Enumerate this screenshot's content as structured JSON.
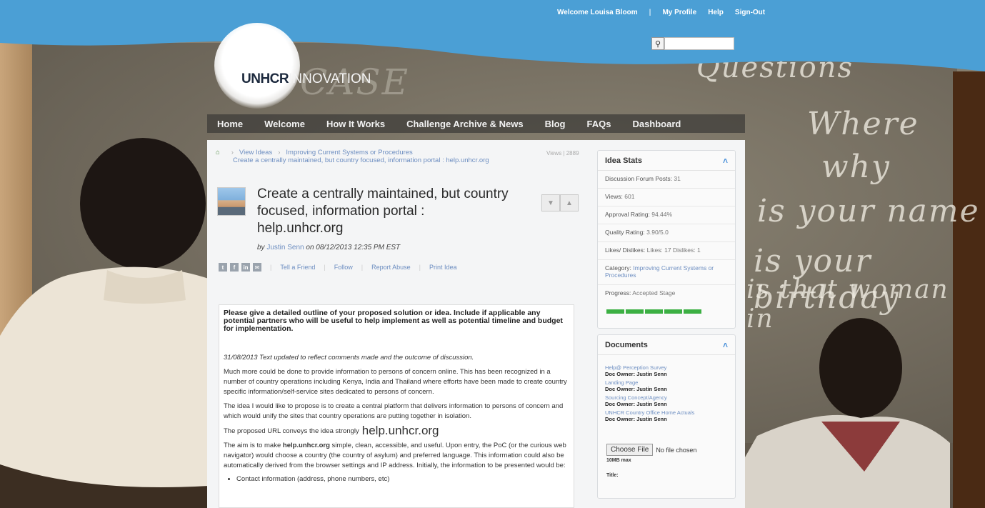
{
  "header": {
    "welcome": "Welcome Louisa Bloom",
    "links": [
      "My Profile",
      "Help",
      "Sign-Out"
    ],
    "logo_main": "UNHCR",
    "logo_sub": "INNOVATION",
    "search_icon": "search-icon"
  },
  "nav": [
    "Home",
    "Welcome",
    "How It Works",
    "Challenge Archive & News",
    "Blog",
    "FAQs",
    "Dashboard"
  ],
  "breadcrumb": {
    "home_icon": "home-icon",
    "items": [
      "View Ideas",
      "Improving Current Systems or Procedures",
      "Create a centrally maintained, but country focused, information portal : help.unhcr.org"
    ],
    "views_label": "Views | 2889"
  },
  "idea": {
    "title": "Create a centrally maintained, but country focused, information portal : help.unhcr.org",
    "by_prefix": "by",
    "author": "Justin Senn",
    "date": "on 08/12/2013 12:35 PM EST",
    "share_icons": [
      "twitter-icon",
      "facebook-icon",
      "linkedin-icon",
      "email-icon"
    ],
    "actions": [
      "Tell a Friend",
      "Follow",
      "Report Abuse",
      "Print Idea"
    ]
  },
  "detail": {
    "question": "Please give a detailed outline of your proposed solution or idea. Include if applicable any potential partners who will be useful to help implement as well as potential timeline and budget for implementation.",
    "update": "31/08/2013 Text updated to reflect comments made and the outcome of discussion.",
    "p1": "Much more could be done to provide information to persons of concern online. This has been recognized in a number of country operations including Kenya, India and Thailand where efforts have been made to create country specific information/self-service sites dedicated to persons of concern.",
    "p2": "The idea I would like to propose is to create a central platform that delivers information to persons of concern and which would unify the sites that country operations are putting together in isolation.",
    "p3_prefix": "The proposed URL conveys the idea strongly",
    "p3_url": "help.unhcr.org",
    "p4_a": "The aim is to make ",
    "p4_bold": "help.unhcr.org",
    "p4_b": " simple, clean, accessible, and useful. Upon entry, the PoC (or the curious web navigator) would choose a country (the country of asylum) and preferred language. This information could also be automatically derived from the browser settings and IP address. Initially, the information to be presented would be:",
    "bullet1": "Contact information (address, phone numbers, etc)"
  },
  "stats": {
    "heading": "Idea Stats",
    "forum_label": "Discussion Forum Posts:",
    "forum_value": "31",
    "views_label": "Views:",
    "views_value": "601",
    "approval_label": "Approval Rating:",
    "approval_value": "94.44%",
    "quality_label": "Quality Rating:",
    "quality_value": "3.90/5.0",
    "likes_label": "Likes/ Dislikes:",
    "likes_value": "Likes: 17 Dislikes: 1",
    "category_label": "Category:",
    "category_value": "Improving Current Systems or Procedures",
    "progress_label": "Progress:",
    "progress_value": "Accepted Stage",
    "progress_segments": 5
  },
  "documents": {
    "heading": "Documents",
    "items": [
      {
        "name": "Help@ Perception Survey",
        "owner": "Doc Owner: Justin Senn"
      },
      {
        "name": "Landing Page",
        "owner": "Doc Owner: Justin Senn"
      },
      {
        "name": "Sourcing Concept/Agency",
        "owner": "Doc Owner: Justin Senn"
      },
      {
        "name": "UNHCR Country Office Home Actuals",
        "owner": "Doc Owner: Justin Senn"
      }
    ],
    "choose_file": "Choose File",
    "no_file": "No file chosen",
    "limit": "10MB max",
    "title_label": "Title:"
  },
  "colors": {
    "topband": "#4b9fd5",
    "progress": "#3cb043",
    "link": "#6d8ec1"
  }
}
